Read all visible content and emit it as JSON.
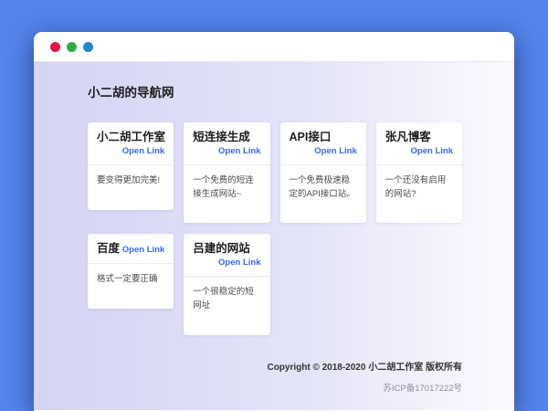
{
  "window": {
    "controls": [
      {
        "name": "close",
        "color": "#e8123e"
      },
      {
        "name": "minimize",
        "color": "#31ac44"
      },
      {
        "name": "maximize",
        "color": "#1b87d3"
      }
    ]
  },
  "header": {
    "title": "小二胡的导航网"
  },
  "cards": [
    {
      "title": "小二胡工作室",
      "link_label": "Open Link",
      "description": "要变得更加完美!"
    },
    {
      "title": "短连接生成",
      "link_label": "Open Link",
      "description": "一个免费的短连接生成网站~"
    },
    {
      "title": "API接口",
      "link_label": "Open Link",
      "description": "一个免费极速稳定的API接口站。"
    },
    {
      "title": "张凡博客",
      "link_label": "Open Link",
      "description": "一个还没有启用的网站?"
    },
    {
      "title": "百度",
      "link_label": "Open Link",
      "description": "格式一定要正确"
    },
    {
      "title": "吕建的网站",
      "link_label": "Open Link",
      "description": "一个很稳定的短网址"
    }
  ],
  "footer": {
    "copyright": "Copyright © 2018-2020 小二胡工作室 版权所有",
    "icp": "苏ICP备17017222号"
  },
  "colors": {
    "desktop_background": "#5584ec",
    "body_gradient_start": "#d4d4f4",
    "body_gradient_end": "#fbfbff",
    "link": "#3567f2",
    "card_background": "#ffffff"
  }
}
